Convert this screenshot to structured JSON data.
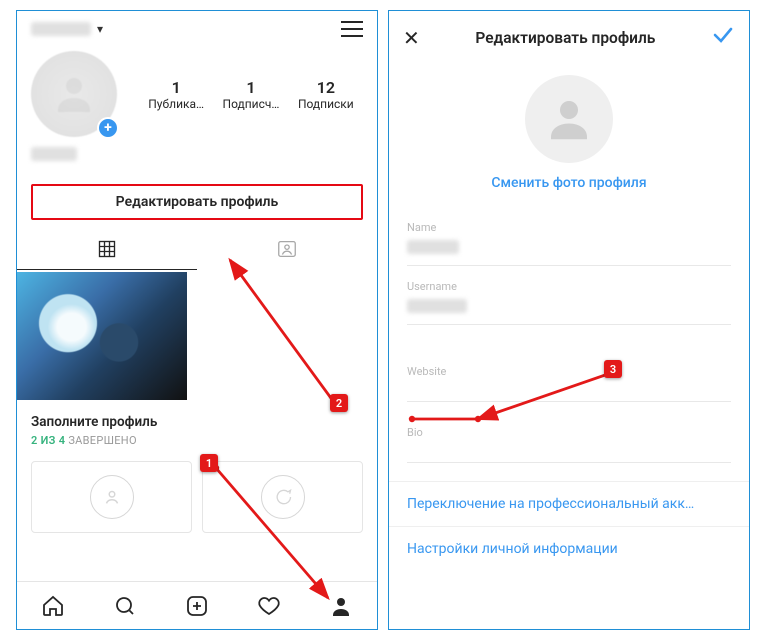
{
  "left": {
    "username_masked": "██_███",
    "stats": {
      "posts": {
        "num": "1",
        "label": "Публика…"
      },
      "followers": {
        "num": "1",
        "label": "Подписч…"
      },
      "following": {
        "num": "12",
        "label": "Подписки"
      }
    },
    "name_masked": "████",
    "edit_button": "Редактировать профиль",
    "complete": {
      "title": "Заполните профиль",
      "done": "2 ИЗ 4",
      "suffix": "ЗАВЕРШЕНО"
    }
  },
  "right": {
    "header_title": "Редактировать профиль",
    "change_photo": "Сменить фото профиля",
    "fields": {
      "name": {
        "label": "Name",
        "value_masked": "████"
      },
      "username": {
        "label": "Username",
        "value_masked": "██_███"
      },
      "website": {
        "label": "Website",
        "value": ""
      },
      "bio": {
        "label": "Bio",
        "value": ""
      }
    },
    "links": {
      "switch_pro": "Переключение на профессиональный акк…",
      "personal_info": "Настройки личной информации"
    }
  },
  "markers": {
    "m1": "1",
    "m2": "2",
    "m3": "3"
  }
}
